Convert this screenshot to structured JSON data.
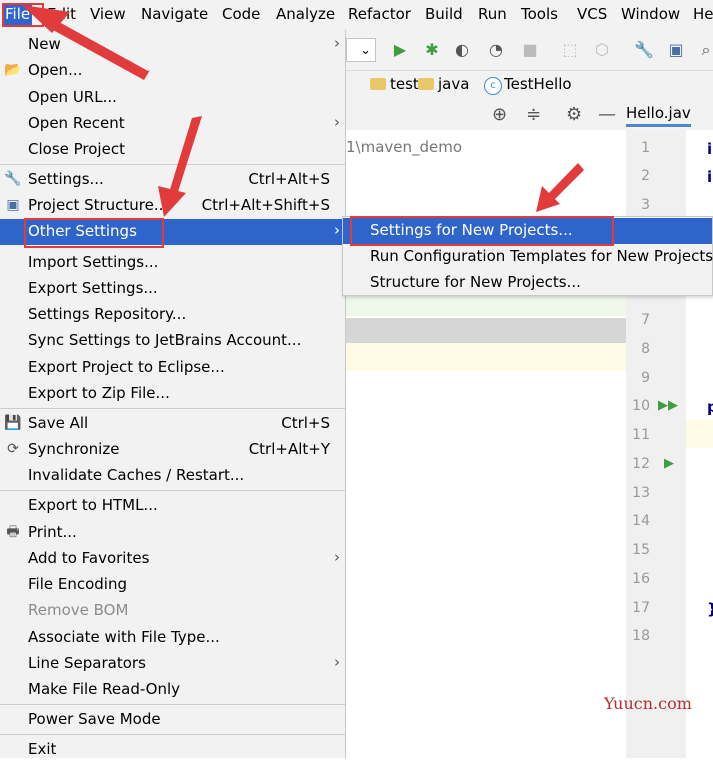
{
  "menubar": {
    "items": [
      "File",
      "Edit",
      "View",
      "Navigate",
      "Code",
      "Analyze",
      "Refactor",
      "Build",
      "Run",
      "Tools",
      "VCS",
      "Window",
      "He"
    ]
  },
  "navbar": {
    "crumbs": [
      "test",
      "java",
      "TestHello"
    ]
  },
  "project": {
    "path": "1\\maven_demo"
  },
  "editor": {
    "tab_label": "Hello.jav",
    "line_numbers": [
      "1",
      "2",
      "3",
      "7",
      "8",
      "9",
      "10",
      "11",
      "12",
      "13",
      "14",
      "15",
      "16",
      "17",
      "18"
    ]
  },
  "file_menu": {
    "items": [
      {
        "label": "New",
        "shortcut": "",
        "submenu": true,
        "icon": "none"
      },
      {
        "label": "Open...",
        "shortcut": "",
        "submenu": false,
        "icon": "folder-open-icon"
      },
      {
        "label": "Open URL...",
        "shortcut": "",
        "submenu": false,
        "icon": "none"
      },
      {
        "label": "Open Recent",
        "shortcut": "",
        "submenu": true,
        "icon": "none"
      },
      {
        "label": "Close Project",
        "shortcut": "",
        "submenu": false,
        "icon": "none"
      },
      {
        "label": "Settings...",
        "shortcut": "Ctrl+Alt+S",
        "submenu": false,
        "icon": "wrench-icon"
      },
      {
        "label": "Project Structure...",
        "shortcut": "Ctrl+Alt+Shift+S",
        "submenu": false,
        "icon": "project-structure-icon"
      },
      {
        "label": "Other Settings",
        "shortcut": "",
        "submenu": true,
        "icon": "none",
        "selected": true
      },
      {
        "label": "Import Settings...",
        "shortcut": "",
        "submenu": false,
        "icon": "none"
      },
      {
        "label": "Export Settings...",
        "shortcut": "",
        "submenu": false,
        "icon": "none"
      },
      {
        "label": "Settings Repository...",
        "shortcut": "",
        "submenu": false,
        "icon": "none"
      },
      {
        "label": "Sync Settings to JetBrains Account...",
        "shortcut": "",
        "submenu": false,
        "icon": "none"
      },
      {
        "label": "Export Project to Eclipse...",
        "shortcut": "",
        "submenu": false,
        "icon": "none"
      },
      {
        "label": "Export to Zip File...",
        "shortcut": "",
        "submenu": false,
        "icon": "none"
      },
      {
        "label": "Save All",
        "shortcut": "Ctrl+S",
        "submenu": false,
        "icon": "save-icon"
      },
      {
        "label": "Synchronize",
        "shortcut": "Ctrl+Alt+Y",
        "submenu": false,
        "icon": "sync-icon"
      },
      {
        "label": "Invalidate Caches / Restart...",
        "shortcut": "",
        "submenu": false,
        "icon": "none"
      },
      {
        "label": "Export to HTML...",
        "shortcut": "",
        "submenu": false,
        "icon": "none"
      },
      {
        "label": "Print...",
        "shortcut": "",
        "submenu": false,
        "icon": "print-icon"
      },
      {
        "label": "Add to Favorites",
        "shortcut": "",
        "submenu": true,
        "icon": "none"
      },
      {
        "label": "File Encoding",
        "shortcut": "",
        "submenu": false,
        "icon": "none"
      },
      {
        "label": "Remove BOM",
        "shortcut": "",
        "submenu": false,
        "icon": "none",
        "disabled": true
      },
      {
        "label": "Associate with File Type...",
        "shortcut": "",
        "submenu": false,
        "icon": "none"
      },
      {
        "label": "Line Separators",
        "shortcut": "",
        "submenu": true,
        "icon": "none"
      },
      {
        "label": "Make File Read-Only",
        "shortcut": "",
        "submenu": false,
        "icon": "none"
      },
      {
        "label": "Power Save Mode",
        "shortcut": "",
        "submenu": false,
        "icon": "none"
      },
      {
        "label": "Exit",
        "shortcut": "",
        "submenu": false,
        "icon": "none"
      }
    ]
  },
  "other_settings_submenu": {
    "items": [
      {
        "label": "Settings for New Projects...",
        "selected": true
      },
      {
        "label": "Run Configuration Templates for New Projects"
      },
      {
        "label": "Structure for New Projects..."
      }
    ]
  },
  "watermark": "Yuucn.com",
  "colors": {
    "selection": "#2f65ca",
    "menu_bg": "#f2f2f2",
    "annotation_red": "#e23b3b",
    "run_green": "#3f9d3f"
  }
}
